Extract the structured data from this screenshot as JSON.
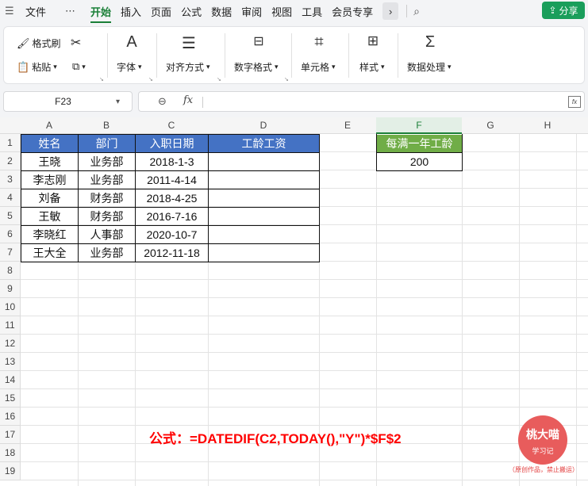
{
  "menu": {
    "items": [
      "文件",
      "开始",
      "插入",
      "页面",
      "公式",
      "数据",
      "审阅",
      "视图",
      "工具",
      "会员专享"
    ],
    "active": "开始",
    "share_label": "分享"
  },
  "ribbon": {
    "format_painter": "格式刷",
    "paste": "粘贴",
    "font": "字体",
    "align": "对齐方式",
    "number_format": "数字格式",
    "cell": "单元格",
    "style": "样式",
    "data_process": "数据处理"
  },
  "formula_bar": {
    "name_box": "F23",
    "formula": ""
  },
  "columns": [
    "A",
    "B",
    "C",
    "D",
    "E",
    "F",
    "G",
    "H"
  ],
  "selected_column": "F",
  "rows": [
    "1",
    "2",
    "3",
    "4",
    "5",
    "6",
    "7",
    "8",
    "9",
    "10",
    "11",
    "12",
    "13",
    "14",
    "15",
    "16",
    "17",
    "18",
    "19"
  ],
  "table": {
    "headers": [
      "姓名",
      "部门",
      "入职日期",
      "工龄工资"
    ],
    "rows": [
      [
        "王晓",
        "业务部",
        "2018-1-3",
        ""
      ],
      [
        "李志刚",
        "业务部",
        "2011-4-14",
        ""
      ],
      [
        "刘备",
        "财务部",
        "2018-4-25",
        ""
      ],
      [
        "王敏",
        "财务部",
        "2016-7-16",
        ""
      ],
      [
        "李晓红",
        "人事部",
        "2020-10-7",
        ""
      ],
      [
        "王大全",
        "业务部",
        "2012-11-18",
        ""
      ]
    ]
  },
  "side": {
    "header": "每满一年工龄",
    "value": "200"
  },
  "annotation": "公式：=DATEDIF(C2,TODAY(),\"Y\")*$F$2",
  "watermark": {
    "line1": "桃大喵",
    "line2": "学习记",
    "note": "（原创作品，禁止搬运）"
  }
}
